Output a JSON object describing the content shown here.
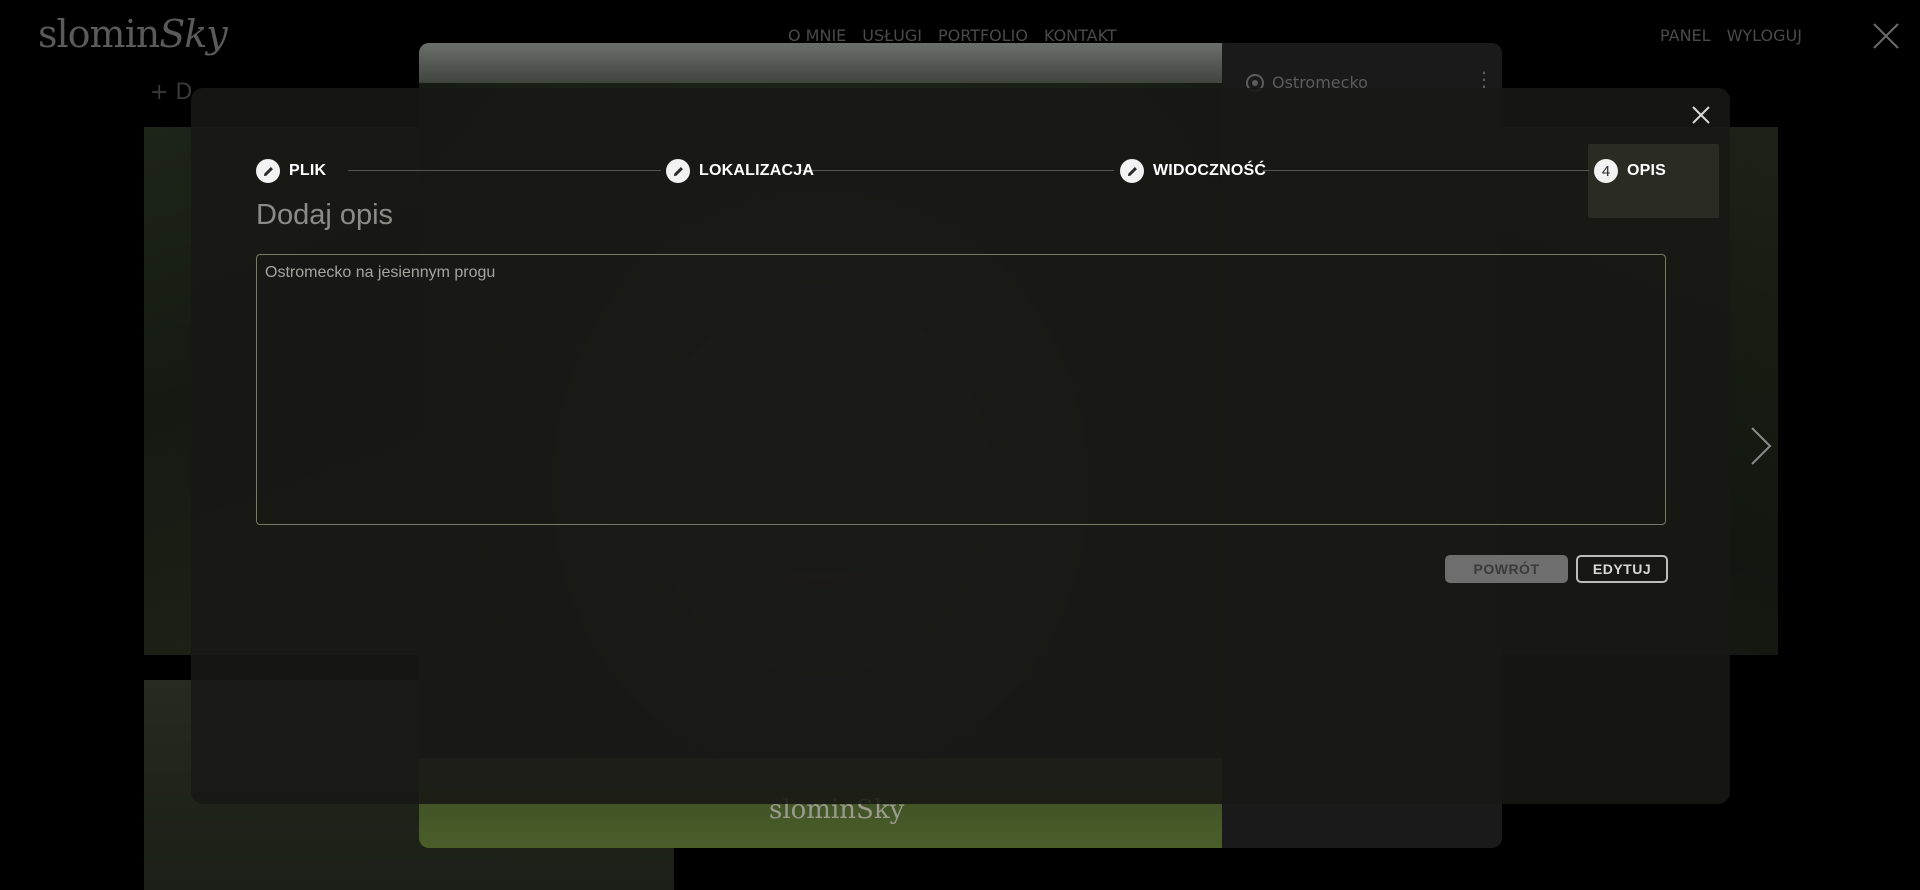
{
  "site": {
    "logo_text": "slomin",
    "logo_script": "Sky",
    "nav": [
      "O MNIE",
      "USŁUGI",
      "PORTFOLIO",
      "KONTAKT"
    ],
    "auth": [
      "PANEL",
      "WYLOGUJ"
    ],
    "add_link": "+ D"
  },
  "viewer": {
    "location": "Ostromecko",
    "watermark": "slominSky"
  },
  "modal": {
    "steps": [
      {
        "label": "PLIK",
        "state": "done",
        "icon": "pencil-icon"
      },
      {
        "label": "LOKALIZACJA",
        "state": "done",
        "icon": "pencil-icon"
      },
      {
        "label": "WIDOCZNOŚĆ",
        "state": "done",
        "icon": "pencil-icon"
      },
      {
        "label": "OPIS",
        "state": "active",
        "number": "4"
      }
    ],
    "title": "Dodaj opis",
    "description_value": "Ostromecko na jesiennym progu",
    "back_button": "POWRÓT",
    "edit_button": "EDYTUJ"
  },
  "colors": {
    "modal_bg": "#181816",
    "accent_border": "#7a7a62",
    "active_step_bg": "#2a2c23"
  }
}
